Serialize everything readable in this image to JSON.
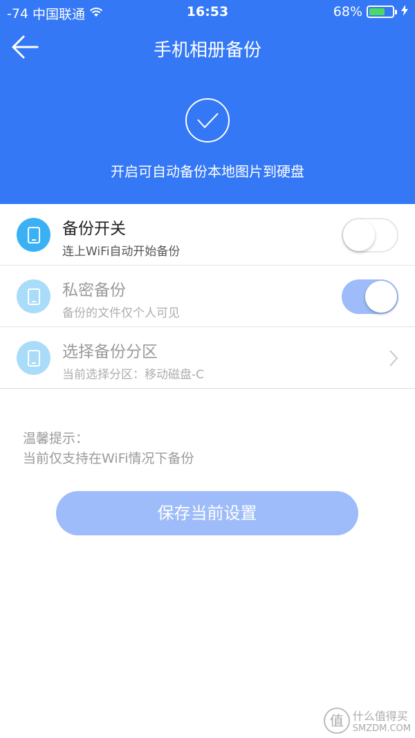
{
  "status_bar": {
    "signal": "-74",
    "carrier": "中国联通",
    "time": "16:53",
    "battery_percent": "68%",
    "battery_level": 0.68,
    "wifi_icon": "wifi-icon",
    "charging_icon": "bolt-icon"
  },
  "header": {
    "title": "手机相册备份",
    "subtitle": "开启可自动备份本地图片到硬盘",
    "back_icon": "arrow-left-icon",
    "check_icon": "check-circle-icon",
    "background_color": "#3478f6"
  },
  "settings": [
    {
      "title": "备份开关",
      "subtitle": "连上WiFi自动开始备份",
      "icon": "phone-icon",
      "icon_color": "#3ab0f5",
      "control": "toggle",
      "toggle_on": false
    },
    {
      "title": "私密备份",
      "subtitle": "备份的文件仅个人可见",
      "icon": "phone-icon",
      "icon_color": "#a9dcf9",
      "control": "toggle",
      "toggle_on": true
    },
    {
      "title": "选择备份分区",
      "subtitle": "当前选择分区：移动磁盘-C",
      "icon": "phone-icon",
      "icon_color": "#a9dcf9",
      "control": "chevron"
    }
  ],
  "tips": {
    "heading": "温馨提示：",
    "text": "当前仅支持在WiFi情况下备份"
  },
  "save_button": {
    "label": "保存当前设置",
    "color": "#9dbcf9"
  },
  "watermark": {
    "badge": "值",
    "text_cn": "什么值得买",
    "text_en": "SMZDM.COM"
  }
}
